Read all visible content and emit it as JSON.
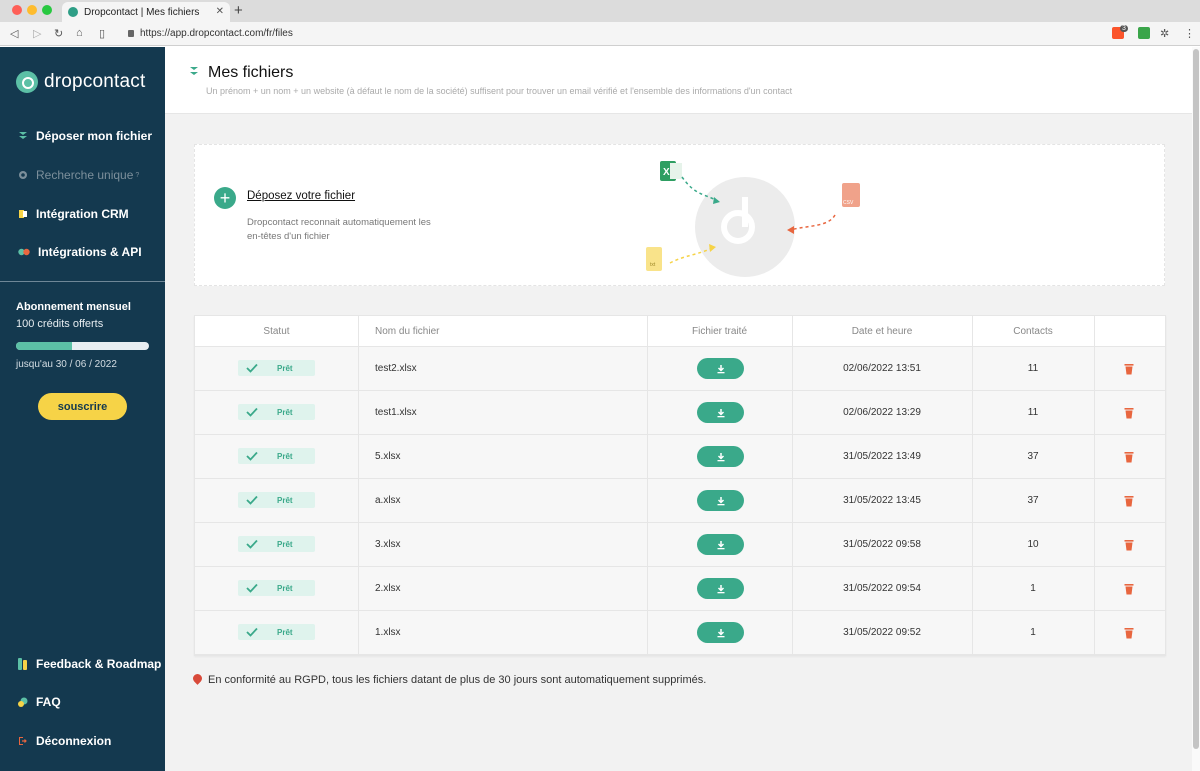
{
  "browser": {
    "tab_title": "Dropcontact | Mes fichiers",
    "tab_close": "✕",
    "new_tab": "+",
    "url": "https://app.dropcontact.com/fr/files",
    "extension_badge": "3"
  },
  "sidebar": {
    "logo_text": "dropcontact",
    "items": [
      {
        "label": "Déposer mon fichier"
      },
      {
        "label": "Recherche unique",
        "badge": "?"
      },
      {
        "label": "Intégration CRM"
      },
      {
        "label": "Intégrations & API"
      }
    ],
    "subscription": {
      "title": "Abonnement mensuel",
      "credits": "100 crédits offerts",
      "progress": 0.42,
      "until": "jusqu'au 30 / 06 / 2022",
      "button": "souscrire"
    },
    "bottom_items": [
      {
        "label": "Feedback & Roadmap"
      },
      {
        "label": "FAQ"
      },
      {
        "label": "Déconnexion"
      }
    ]
  },
  "header": {
    "title": "Mes fichiers",
    "subtitle": "Un prénom + un nom + un website (à défaut le nom de la société) suffisent pour trouver un email vérifié et l'ensemble des informations d'un contact"
  },
  "dropzone": {
    "title": "Déposez votre fichier",
    "description": "Dropcontact reconnait automatiquement les en-têtes d'un fichier",
    "csv_label": "CSV",
    "txt_label": "txt"
  },
  "table": {
    "columns": [
      "Statut",
      "Nom du fichier",
      "Fichier traité",
      "Date et heure",
      "Contacts"
    ],
    "rows": [
      {
        "status": "Prêt",
        "file": "test2.xlsx",
        "datetime": "02/06/2022 13:51",
        "contacts": "11"
      },
      {
        "status": "Prêt",
        "file": "test1.xlsx",
        "datetime": "02/06/2022 13:29",
        "contacts": "11"
      },
      {
        "status": "Prêt",
        "file": "5.xlsx",
        "datetime": "31/05/2022 13:49",
        "contacts": "37"
      },
      {
        "status": "Prêt",
        "file": "a.xlsx",
        "datetime": "31/05/2022 13:45",
        "contacts": "37"
      },
      {
        "status": "Prêt",
        "file": "3.xlsx",
        "datetime": "31/05/2022 09:58",
        "contacts": "10"
      },
      {
        "status": "Prêt",
        "file": "2.xlsx",
        "datetime": "31/05/2022 09:54",
        "contacts": "1"
      },
      {
        "status": "Prêt",
        "file": "1.xlsx",
        "datetime": "31/05/2022 09:52",
        "contacts": "1"
      }
    ]
  },
  "footer_note": "En conformité au RGPD, tous les fichiers datant de plus de 30 jours sont automatiquement supprimés.",
  "colors": {
    "sidebar": "#14394f",
    "accent": "#3aa98a",
    "subscribe": "#f6d347",
    "delete": "#e8663f"
  }
}
